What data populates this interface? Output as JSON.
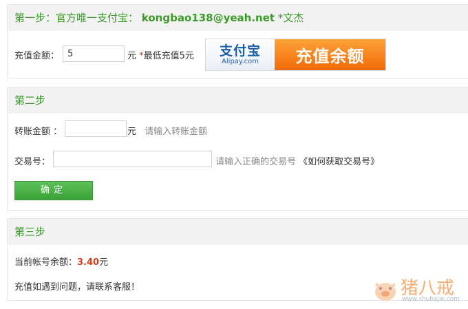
{
  "step1": {
    "title_prefix": "第一步：官方唯一支付宝：",
    "account": "kongbao138@yeah.net",
    "owner": "*文杰",
    "amount_label": "充值金额：",
    "amount_value": "5",
    "currency": "元",
    "min_note_star": "*",
    "min_note": "最低充值5元",
    "alipay_logo": "支付宝",
    "alipay_domain": "Alipay.com",
    "recharge_button": "充值余额"
  },
  "step2": {
    "title": "第二步",
    "transfer_label": "转账金额 ：",
    "transfer_currency": "元",
    "transfer_hint": "请输入转账金额",
    "trade_label": "交易号：",
    "trade_hint": "请输入正确的交易号",
    "trade_link": "《如何获取交易号》",
    "submit_label": "确定"
  },
  "step3": {
    "title": "第三步",
    "balance_label": "当前帐号余额：",
    "balance_value": "3.40",
    "balance_unit": "元",
    "help_text": "充值如遇到问题，请联系客服！"
  },
  "watermark": {
    "text": "猪八戒",
    "url": "www.shubajie.com"
  },
  "colors": {
    "accent_green": "#3c9a2a",
    "alipay_orange": "#f26a06",
    "alipay_blue": "#1a5fa8",
    "balance_red": "#e03a1e"
  }
}
